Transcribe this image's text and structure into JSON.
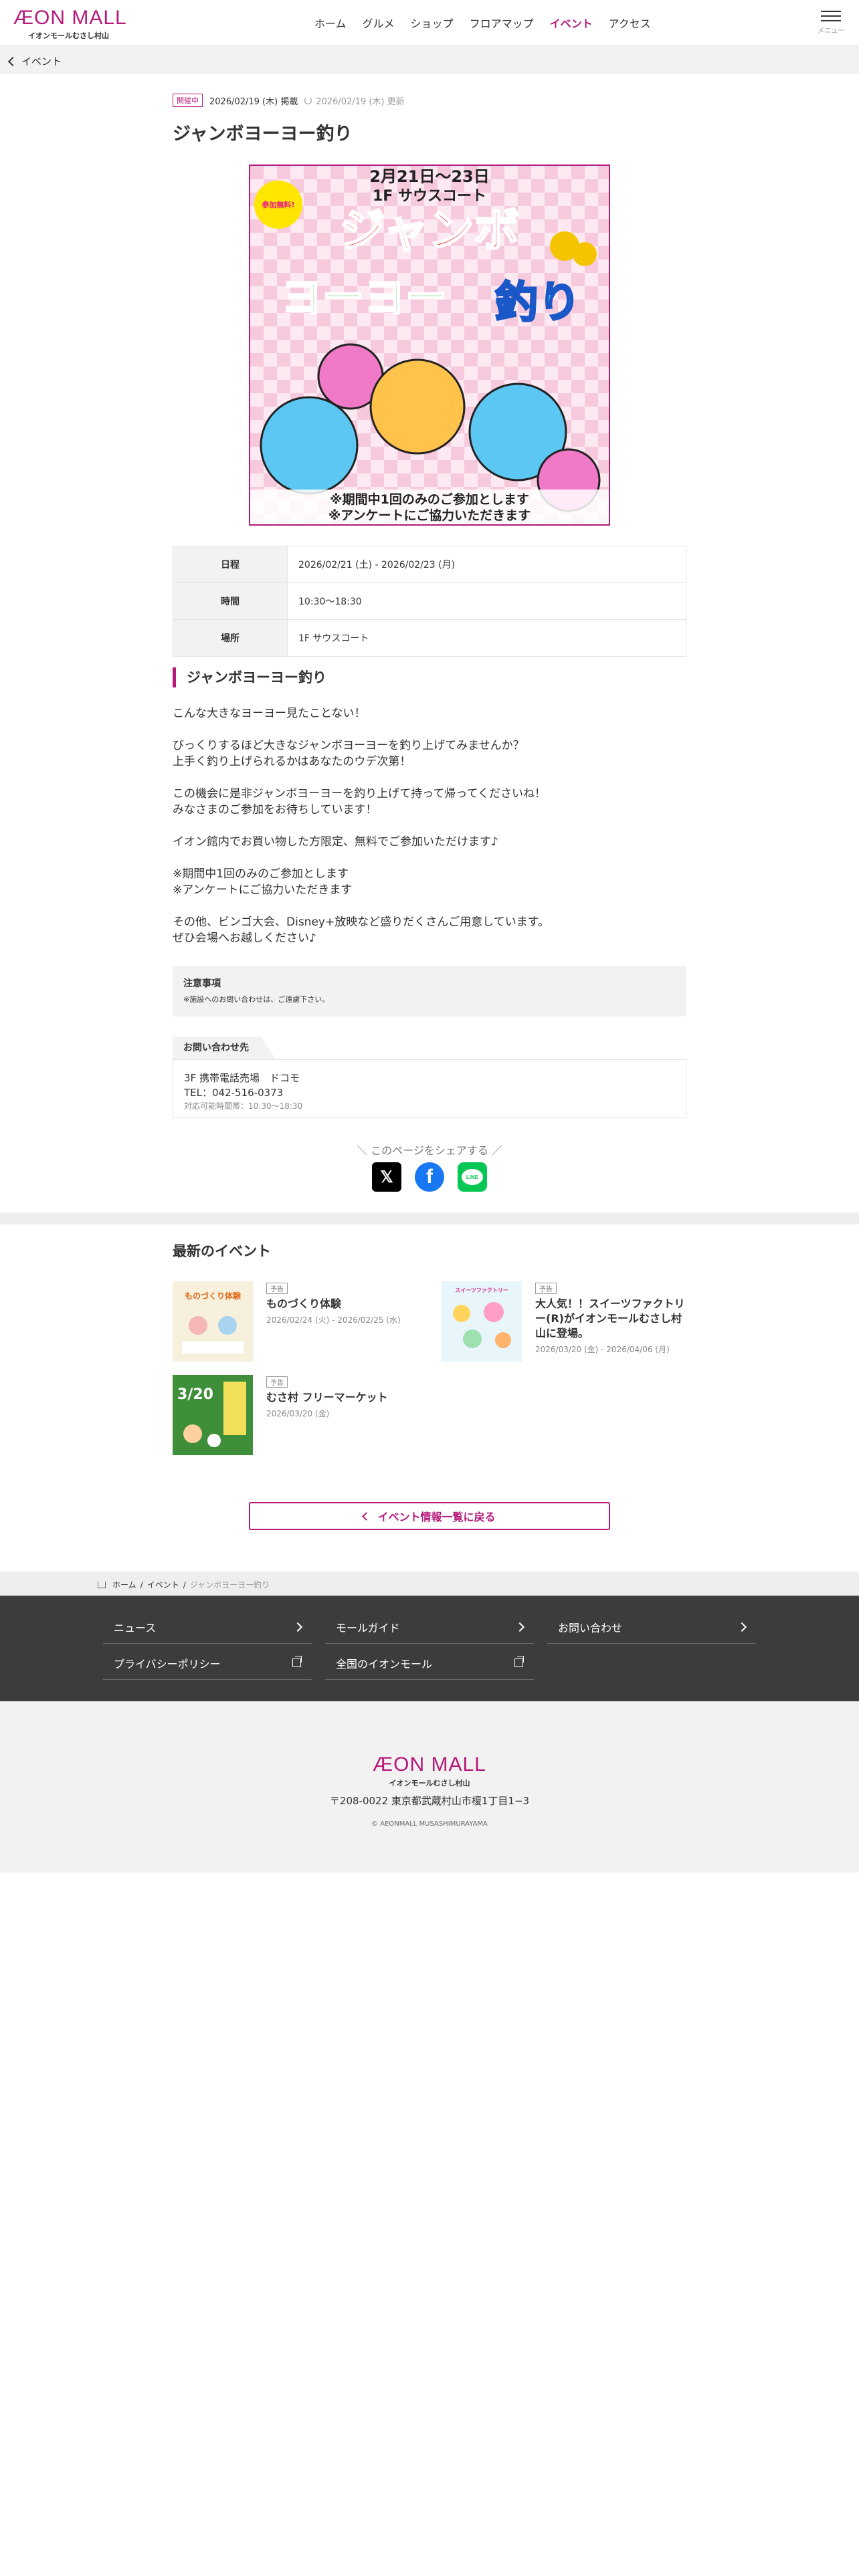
{
  "colors": {
    "brand": "#b5197a",
    "text": "#333333",
    "footer_dark": "#3c3c3c",
    "light_bg": "#f2f2f2"
  },
  "header": {
    "logo_main": "ÆON MALL",
    "logo_sub": "イオンモールむさし村山",
    "nav": [
      "ホーム",
      "グルメ",
      "ショップ",
      "フロアマップ",
      "イベント",
      "アクセス"
    ],
    "active_nav": "イベント",
    "menu_label": "メニュー"
  },
  "subbar": {
    "back_label": "イベント"
  },
  "article": {
    "status_badge": "開催中",
    "published": "2026/02/19 (木) 掲載",
    "updated": "2026/02/19 (木) 更新",
    "title": "ジャンボヨーヨー釣り",
    "poster": {
      "dates": "2月21日〜23日",
      "place": "1F サウスコート",
      "free_badge": "参加無料!",
      "headline_1": "ジャンボ",
      "headline_2": "ヨーヨー",
      "headline_3": "釣り",
      "note_1": "※期間中1回のみのご参加とします",
      "note_2": "※アンケートにご協力いただきます"
    },
    "info": [
      {
        "label": "日程",
        "value": "2026/02/21 (土) - 2026/02/23 (月)"
      },
      {
        "label": "時間",
        "value": "10:30〜18:30"
      },
      {
        "label": "場所",
        "value": "1F サウスコート"
      }
    ],
    "section_title": "ジャンボヨーヨー釣り",
    "body": [
      "こんな大きなヨーヨー見たことない！",
      "",
      "びっくりするほど大きなジャンボヨーヨーを釣り上げてみませんか？",
      "上手く釣り上げられるかはあなたのウデ次第！",
      "",
      "この機会に是非ジャンボヨーヨーを釣り上げて持って帰ってくださいね！",
      "みなさまのご参加をお待ちしています！",
      "",
      "イオン館内でお買い物した方限定、無料でご参加いただけます♪",
      "",
      "※期間中1回のみのご参加とします",
      "※アンケートにご協力いただきます",
      "",
      "その他、ビンゴ大会、Disney+放映など盛りだくさんご用意しています。",
      "ぜひ会場へお越しください♪"
    ],
    "note": {
      "title": "注意事項",
      "body": "※施設へのお問い合わせは、ご遠慮下さい。"
    },
    "contact": {
      "tab": "お問い合わせ先",
      "shop": "3F 携帯電話売場　ドコモ",
      "tel": "TEL：042-516-0373",
      "hours": "対応可能時間帯：10:30〜18:30"
    },
    "share_label": "＼ このページをシェアする ／",
    "share": {
      "x": "𝕏",
      "facebook": "f",
      "line": "LINE"
    }
  },
  "latest": {
    "title": "最新のイベント",
    "events": [
      {
        "badge": "予告",
        "title": "ものづくり体験",
        "date": "2026/02/24 (火) - 2026/02/25 (水)",
        "thumb_text": "ものづくり体験"
      },
      {
        "badge": "予告",
        "title": "大人気！！スイーツファクトリー(R)がイオンモールむさし村山に登場。",
        "date": "2026/03/20 (金) - 2026/04/06 (月)",
        "thumb_text": "スイーツファクトリー"
      },
      {
        "badge": "予告",
        "title": "むさ村 フリーマーケット",
        "date": "2026/03/20 (金)",
        "thumb_text": "3/20"
      }
    ]
  },
  "back_to_list": "イベント情報一覧に戻る",
  "breadcrumb": {
    "home": "ホーム",
    "events": "イベント",
    "current": "ジャンボヨーヨー釣り"
  },
  "footer_nav": [
    {
      "label": "ニュース",
      "icon": "chevron-right-icon"
    },
    {
      "label": "モールガイド",
      "icon": "chevron-right-icon"
    },
    {
      "label": "お問い合わせ",
      "icon": "chevron-right-icon"
    },
    {
      "label": "プライバシーポリシー",
      "icon": "external-link-icon"
    },
    {
      "label": "全国のイオンモール",
      "icon": "external-link-icon"
    }
  ],
  "footer": {
    "logo_main": "ÆON MALL",
    "logo_sub": "イオンモールむさし村山",
    "address": "〒208-0022 東京都武蔵村山市榎1丁目1−3",
    "copyright": "© AEONMALL MUSASHIMURAYAMA"
  }
}
